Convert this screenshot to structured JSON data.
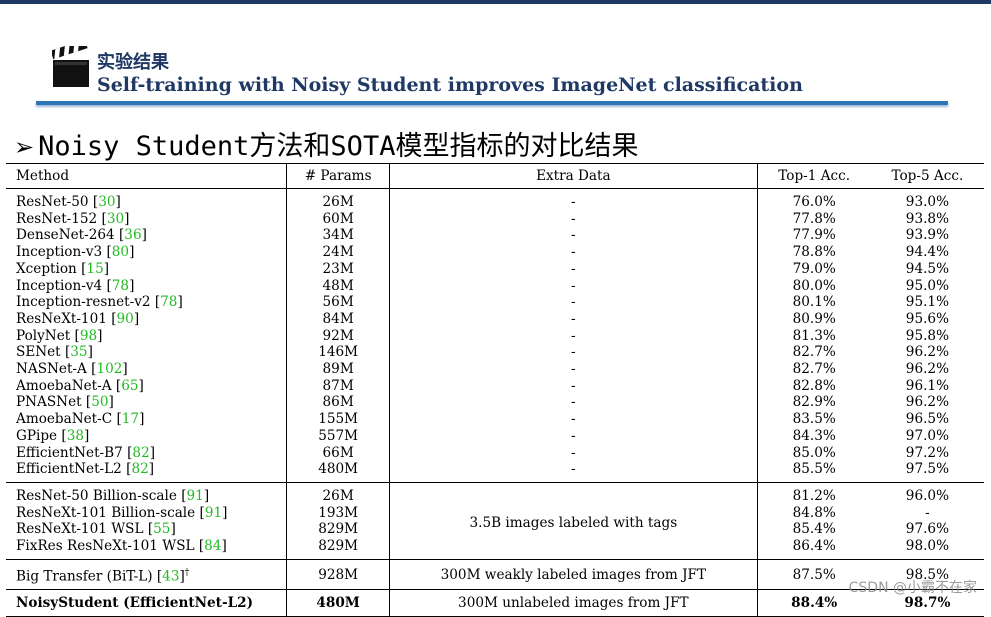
{
  "header": {
    "title_cn": "实验结果",
    "title_en": "Self-training with Noisy Student improves ImageNet classification"
  },
  "heading": {
    "bullet": "➢",
    "text": "Noisy Student方法和SOTA模型指标的对比结果"
  },
  "table": {
    "columns": [
      "Method",
      "# Params",
      "Extra Data",
      "Top-1 Acc.",
      "Top-5 Acc."
    ],
    "group1": [
      {
        "name": "ResNet-50",
        "ref": "30",
        "params": "26M",
        "extra": "-",
        "top1": "76.0%",
        "top5": "93.0%"
      },
      {
        "name": "ResNet-152",
        "ref": "30",
        "params": "60M",
        "extra": "-",
        "top1": "77.8%",
        "top5": "93.8%"
      },
      {
        "name": "DenseNet-264",
        "ref": "36",
        "params": "34M",
        "extra": "-",
        "top1": "77.9%",
        "top5": "93.9%"
      },
      {
        "name": "Inception-v3",
        "ref": "80",
        "params": "24M",
        "extra": "-",
        "top1": "78.8%",
        "top5": "94.4%"
      },
      {
        "name": "Xception",
        "ref": "15",
        "params": "23M",
        "extra": "-",
        "top1": "79.0%",
        "top5": "94.5%"
      },
      {
        "name": "Inception-v4",
        "ref": "78",
        "params": "48M",
        "extra": "-",
        "top1": "80.0%",
        "top5": "95.0%"
      },
      {
        "name": "Inception-resnet-v2",
        "ref": "78",
        "params": "56M",
        "extra": "-",
        "top1": "80.1%",
        "top5": "95.1%"
      },
      {
        "name": "ResNeXt-101",
        "ref": "90",
        "params": "84M",
        "extra": "-",
        "top1": "80.9%",
        "top5": "95.6%"
      },
      {
        "name": "PolyNet",
        "ref": "98",
        "params": "92M",
        "extra": "-",
        "top1": "81.3%",
        "top5": "95.8%"
      },
      {
        "name": "SENet",
        "ref": "35",
        "params": "146M",
        "extra": "-",
        "top1": "82.7%",
        "top5": "96.2%"
      },
      {
        "name": "NASNet-A",
        "ref": "102",
        "params": "89M",
        "extra": "-",
        "top1": "82.7%",
        "top5": "96.2%"
      },
      {
        "name": "AmoebaNet-A",
        "ref": "65",
        "params": "87M",
        "extra": "-",
        "top1": "82.8%",
        "top5": "96.1%"
      },
      {
        "name": "PNASNet",
        "ref": "50",
        "params": "86M",
        "extra": "-",
        "top1": "82.9%",
        "top5": "96.2%"
      },
      {
        "name": "AmoebaNet-C",
        "ref": "17",
        "params": "155M",
        "extra": "-",
        "top1": "83.5%",
        "top5": "96.5%"
      },
      {
        "name": "GPipe",
        "ref": "38",
        "params": "557M",
        "extra": "-",
        "top1": "84.3%",
        "top5": "97.0%"
      },
      {
        "name": "EfficientNet-B7",
        "ref": "82",
        "params": "66M",
        "extra": "-",
        "top1": "85.0%",
        "top5": "97.2%"
      },
      {
        "name": "EfficientNet-L2",
        "ref": "82",
        "params": "480M",
        "extra": "-",
        "top1": "85.5%",
        "top5": "97.5%"
      }
    ],
    "group2_extra": "3.5B images labeled with tags",
    "group2": [
      {
        "name": "ResNet-50 Billion-scale",
        "ref": "91",
        "params": "26M",
        "top1": "81.2%",
        "top5": "96.0%"
      },
      {
        "name": "ResNeXt-101 Billion-scale",
        "ref": "91",
        "params": "193M",
        "top1": "84.8%",
        "top5": "-"
      },
      {
        "name": "ResNeXt-101 WSL",
        "ref": "55",
        "params": "829M",
        "top1": "85.4%",
        "top5": "97.6%"
      },
      {
        "name": "FixRes ResNeXt-101 WSL",
        "ref": "84",
        "params": "829M",
        "top1": "86.4%",
        "top5": "98.0%"
      }
    ],
    "bit": {
      "name": "Big Transfer (BiT-L)",
      "ref": "43",
      "mark": "†",
      "params": "928M",
      "extra": "300M weakly labeled images from JFT",
      "top1": "87.5%",
      "top5": "98.5%"
    },
    "noisy": {
      "name": "NoisyStudent (EfficientNet-L2)",
      "params": "480M",
      "extra": "300M unlabeled images from JFT",
      "top1": "88.4%",
      "top5": "98.7%"
    }
  },
  "watermark": "CSDN @小霸不在家",
  "colors": {
    "title": "#1f3864",
    "rule": "#2e75b6",
    "ref": "#22bb22"
  }
}
